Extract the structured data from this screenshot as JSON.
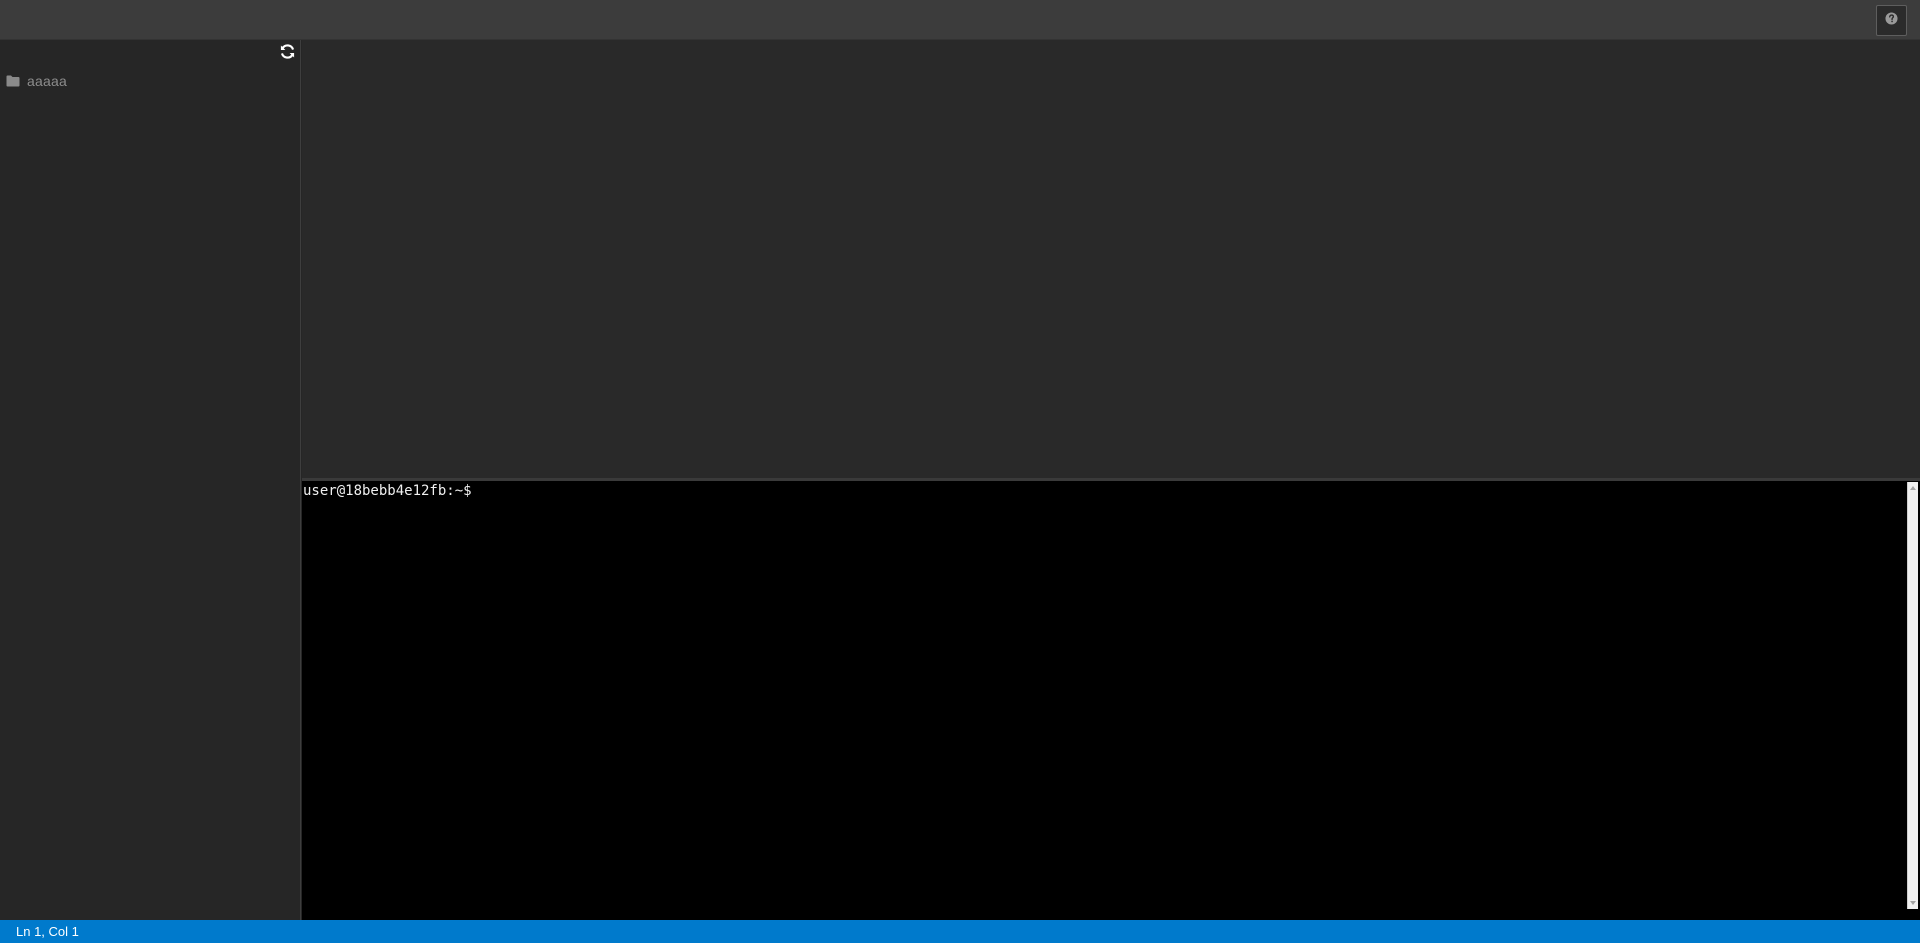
{
  "topbar": {
    "help_icon": "question-circle-icon"
  },
  "sidebar": {
    "refresh_icon": "refresh-icon",
    "items": [
      {
        "label": "aaaaa",
        "icon": "folder-icon"
      }
    ]
  },
  "terminal": {
    "prompt": "user@18bebb4e12fb:~$ "
  },
  "statusbar": {
    "position": "Ln 1, Col 1",
    "color": "#007acc"
  }
}
